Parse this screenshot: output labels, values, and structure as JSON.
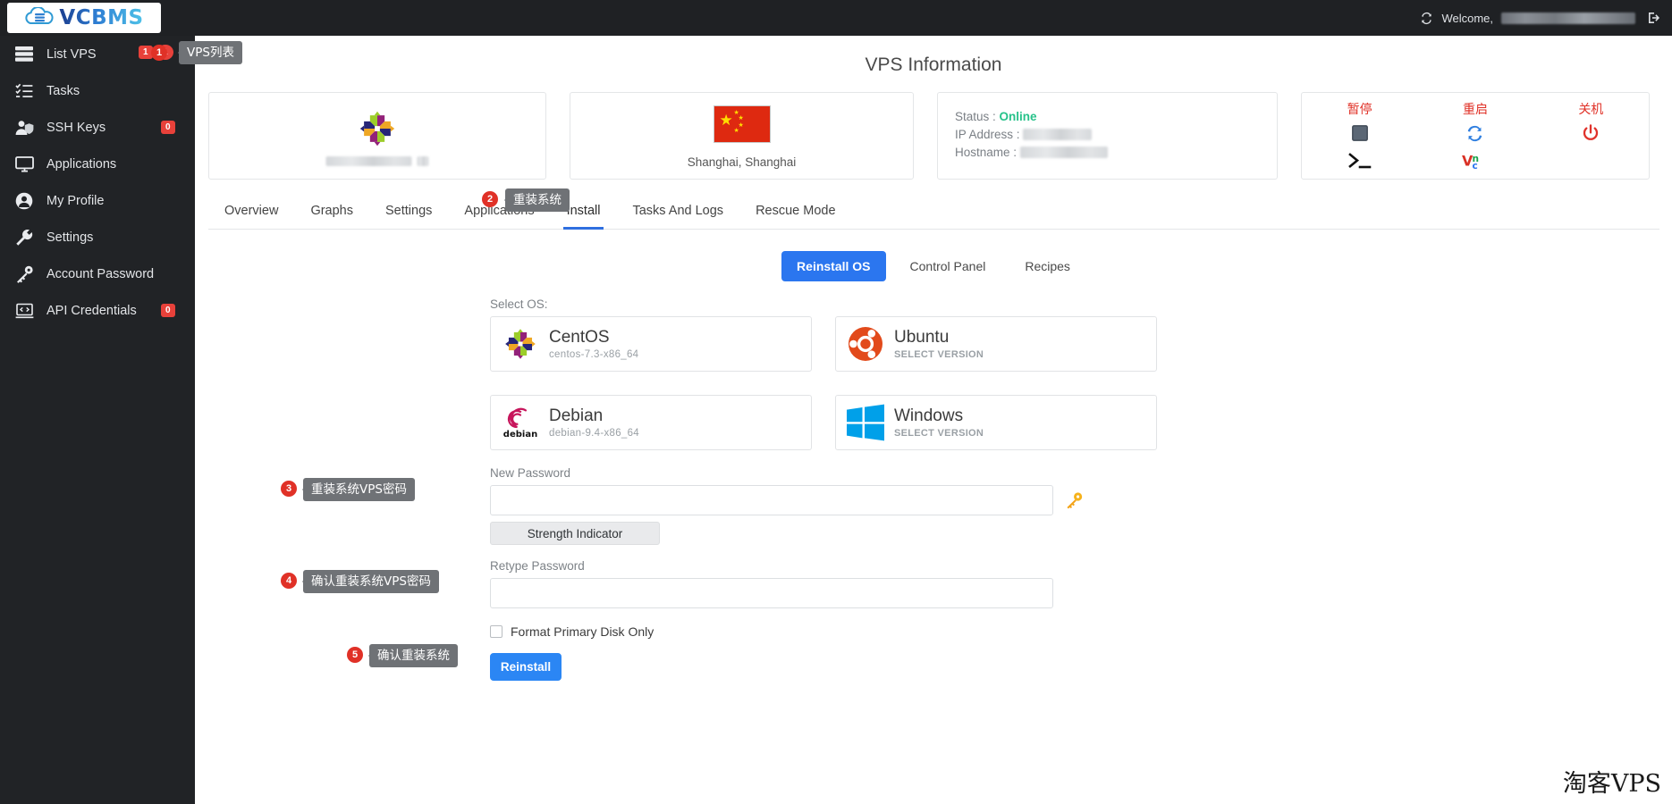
{
  "topbar": {
    "brand": "VCBMS",
    "brand_icon": "cloud-server-icon",
    "refresh_icon": "refresh-icon",
    "welcome_label": "Welcome,",
    "welcome_user_redacted": "",
    "logout_icon": "logout-icon"
  },
  "sidebar": {
    "items": [
      {
        "label": "List VPS",
        "icon": "server-list-icon",
        "badge": "1",
        "badge2": "1"
      },
      {
        "label": "Tasks",
        "icon": "task-list-icon",
        "badge": ""
      },
      {
        "label": "SSH Keys",
        "icon": "user-shield-icon",
        "badge": "0"
      },
      {
        "label": "Applications",
        "icon": "monitor-icon",
        "badge": ""
      },
      {
        "label": "My Profile",
        "icon": "user-circle-icon",
        "badge": ""
      },
      {
        "label": "Settings",
        "icon": "wrench-icon",
        "badge": ""
      },
      {
        "label": "Account Password",
        "icon": "key-icon",
        "badge": ""
      },
      {
        "label": "API Credentials",
        "icon": "code-laptop-icon",
        "badge": "0"
      }
    ]
  },
  "tooltips": [
    {
      "num": "1",
      "text": "VPS列表"
    },
    {
      "num": "2",
      "text": "重装系统"
    },
    {
      "num": "3",
      "text": "重装系统VPS密码"
    },
    {
      "num": "4",
      "text": "确认重装系统VPS密码"
    },
    {
      "num": "5",
      "text": "确认重装系统"
    }
  ],
  "page": {
    "title": "VPS Information"
  },
  "cards": {
    "os_card": {
      "logo": "centos-logo-icon",
      "name_redacted": ""
    },
    "loc_card": {
      "flag": "china-flag-icon",
      "location": "Shanghai, Shanghai"
    },
    "stat_card": {
      "status_label": "Status :",
      "status_value": "Online",
      "ip_label": "IP Address :",
      "ip_value_redacted": "",
      "host_label": "Hostname :",
      "host_value_redacted": ""
    },
    "action_card": {
      "actions": [
        {
          "label": "暂停",
          "icon": "stop-square-icon",
          "sub_icon": "console-terminal-icon"
        },
        {
          "label": "重启",
          "icon": "restart-refresh-icon",
          "sub_icon": "vnc-icon"
        },
        {
          "label": "关机",
          "icon": "power-off-icon",
          "sub_icon": ""
        }
      ]
    }
  },
  "tabs": [
    {
      "label": "Overview",
      "active": false
    },
    {
      "label": "Graphs",
      "active": false
    },
    {
      "label": "Settings",
      "active": false
    },
    {
      "label": "Applications",
      "active": false
    },
    {
      "label": "Install",
      "active": true
    },
    {
      "label": "Tasks And Logs",
      "active": false
    },
    {
      "label": "Rescue Mode",
      "active": false
    }
  ],
  "subtabs": [
    {
      "label": "Reinstall OS",
      "active": true
    },
    {
      "label": "Control Panel",
      "active": false
    },
    {
      "label": "Recipes",
      "active": false
    }
  ],
  "form": {
    "select_os_label": "Select OS:",
    "os_options": [
      {
        "name": "CentOS",
        "version": "centos-7.3-x86_64",
        "caps": false,
        "logo": "centos-logo-icon"
      },
      {
        "name": "Ubuntu",
        "version": "SELECT VERSION",
        "caps": true,
        "logo": "ubuntu-logo-icon"
      },
      {
        "name": "Debian",
        "version": "debian-9.4-x86_64",
        "caps": false,
        "logo": "debian-logo-icon"
      },
      {
        "name": "Windows",
        "version": "SELECT VERSION",
        "caps": true,
        "logo": "windows-logo-icon"
      }
    ],
    "new_password_label": "New Password",
    "new_password_value": "",
    "key_icon": "key-generate-icon",
    "strength_label": "Strength Indicator",
    "retype_password_label": "Retype Password",
    "retype_password_value": "",
    "format_disk_label": "Format Primary Disk Only",
    "format_disk_checked": false,
    "reinstall_button": "Reinstall"
  },
  "watermark": "淘客VPS",
  "colors": {
    "accent": "#2b76ef",
    "sidebar_bg": "#212326",
    "topbar_bg": "#1f2124",
    "badge_red": "#e8413a",
    "online_green": "#27c28a",
    "tooltip_gray": "#6f7276"
  }
}
